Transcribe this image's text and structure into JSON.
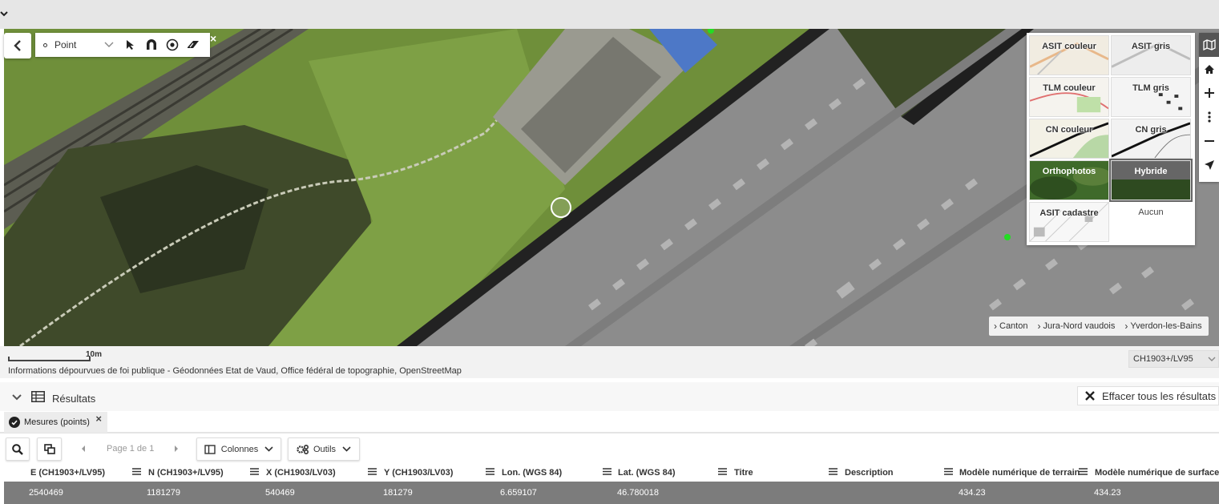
{
  "map": {
    "draw_toolbar": {
      "geometry_type": "Point",
      "tools": [
        "select-arrow-icon",
        "snap-magnet-icon",
        "target-icon",
        "eraser-icon"
      ]
    },
    "basemaps": [
      {
        "label": "ASIT couleur"
      },
      {
        "label": "ASIT gris"
      },
      {
        "label": "TLM couleur"
      },
      {
        "label": "TLM gris"
      },
      {
        "label": "CN couleur"
      },
      {
        "label": "CN gris"
      },
      {
        "label": "Orthophotos"
      },
      {
        "label": "Hybride",
        "selected": true
      },
      {
        "label": "ASIT cadastre"
      },
      {
        "label": "Aucun"
      }
    ],
    "right_toolbar": [
      "map-layers-icon",
      "home-icon",
      "zoom-in-icon",
      "more-icon",
      "zoom-out-icon",
      "locate-icon"
    ],
    "breadcrumb": [
      "Canton",
      "Jura-Nord vaudois",
      "Yverdon-les-Bains"
    ],
    "scale_label": "10m",
    "attribution": "Informations dépourvues de foi publique - Géodonnées Etat de Vaud, Office fédéral de topographie, OpenStreetMap",
    "crs": "CH1903+/LV95"
  },
  "results": {
    "title": "Résultats",
    "clear_label": "Effacer tous les résultats",
    "tab_label": "Mesures (points)",
    "pager": "Page 1 de 1",
    "columns_label": "Colonnes",
    "tools_label": "Outils",
    "headers": [
      "E (CH1903+/LV95)",
      "N (CH1903+/LV95)",
      "X (CH1903/LV03)",
      "Y (CH1903/LV03)",
      "Lon. (WGS 84)",
      "Lat. (WGS 84)",
      "Titre",
      "Description",
      "Modèle numérique de terrain",
      "Modèle numérique de surface"
    ],
    "row": [
      "2540469",
      "1181279",
      "540469",
      "181279",
      "6.659107",
      "46.780018",
      "",
      "",
      "434.23",
      "434.23"
    ]
  },
  "colors": {
    "selected_row": "#7c7c7c",
    "grass": "#6f8f3a",
    "roof": "#8c8c8c",
    "marker": "#22dd22"
  }
}
